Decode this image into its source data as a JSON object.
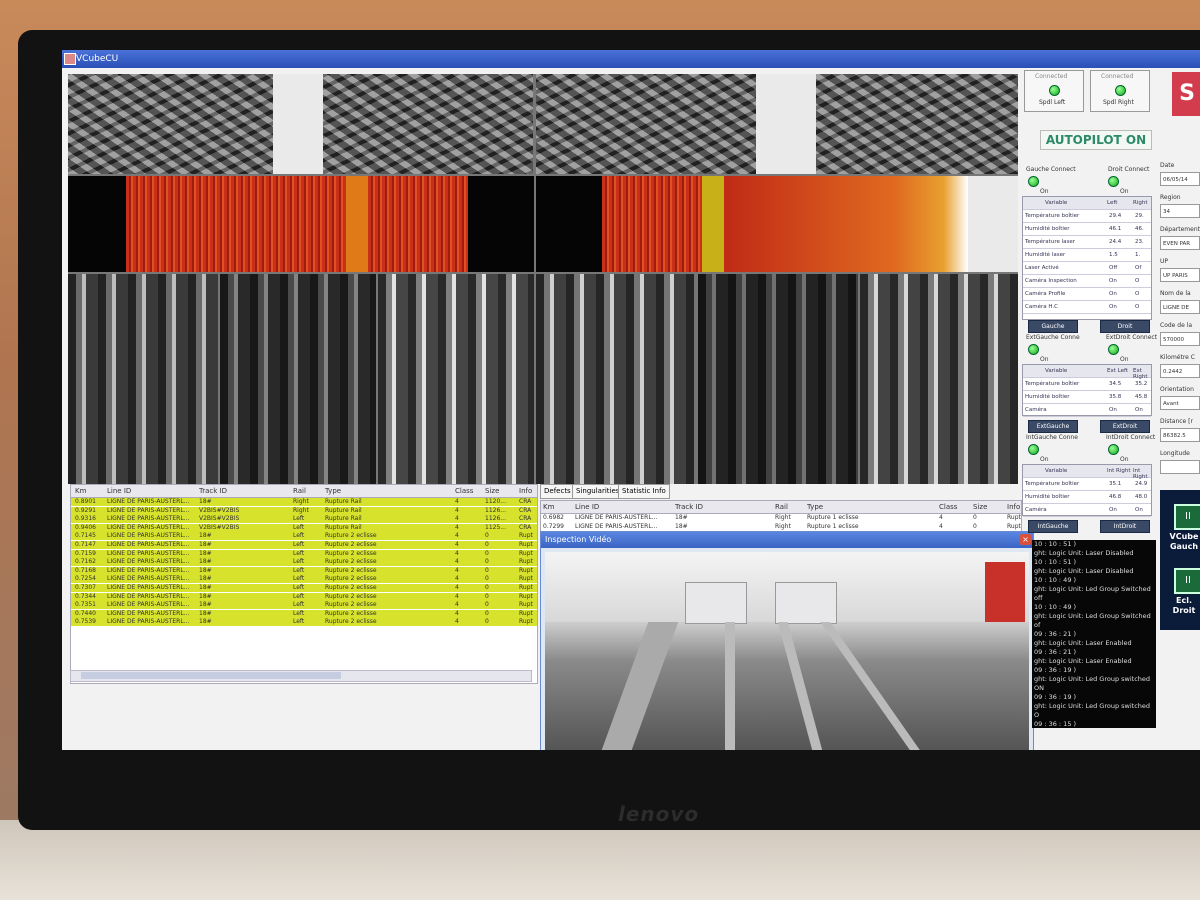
{
  "window": {
    "title": "VCubeCU"
  },
  "monitor": {
    "brand": "lenovo"
  },
  "cam_table": {
    "columns": [
      "Km",
      "Line ID",
      "Track ID",
      "Rail",
      "Type",
      "Class",
      "Size",
      "Info"
    ],
    "rows": [
      [
        "0.8901",
        "LIGNE DE PARIS-AUSTERL...",
        "18#",
        "Right",
        "Rupture Rail",
        "4",
        "1120...",
        "CRA"
      ],
      [
        "0.9291",
        "LIGNE DE PARIS-AUSTERL...",
        "V2BIS#V2BIS",
        "Right",
        "Rupture Rail",
        "4",
        "1126...",
        "CRA"
      ],
      [
        "0.9316",
        "LIGNE DE PARIS-AUSTERL...",
        "V2BIS#V2BIS",
        "Left",
        "Rupture Rail",
        "4",
        "1126...",
        "CRA"
      ],
      [
        "0.9406",
        "LIGNE DE PARIS-AUSTERL...",
        "V2BIS#V2BIS",
        "Left",
        "Rupture Rail",
        "4",
        "1125...",
        "CRA"
      ],
      [
        "0.7145",
        "LIGNE DE PARIS-AUSTERL...",
        "18#",
        "Left",
        "Rupture 2 eclisse",
        "4",
        "0",
        "Rupt"
      ],
      [
        "0.7147",
        "LIGNE DE PARIS-AUSTERL...",
        "18#",
        "Left",
        "Rupture 2 eclisse",
        "4",
        "0",
        "Rupt"
      ],
      [
        "0.7159",
        "LIGNE DE PARIS-AUSTERL...",
        "18#",
        "Left",
        "Rupture 2 eclisse",
        "4",
        "0",
        "Rupt"
      ],
      [
        "0.7162",
        "LIGNE DE PARIS-AUSTERL...",
        "18#",
        "Left",
        "Rupture 2 eclisse",
        "4",
        "0",
        "Rupt"
      ],
      [
        "0.7168",
        "LIGNE DE PARIS-AUSTERL...",
        "18#",
        "Left",
        "Rupture 2 eclisse",
        "4",
        "0",
        "Rupt"
      ],
      [
        "0.7254",
        "LIGNE DE PARIS-AUSTERL...",
        "18#",
        "Left",
        "Rupture 2 eclisse",
        "4",
        "0",
        "Rupt"
      ],
      [
        "0.7307",
        "LIGNE DE PARIS-AUSTERL...",
        "18#",
        "Left",
        "Rupture 2 eclisse",
        "4",
        "0",
        "Rupt"
      ],
      [
        "0.7344",
        "LIGNE DE PARIS-AUSTERL...",
        "18#",
        "Left",
        "Rupture 2 eclisse",
        "4",
        "0",
        "Rupt"
      ],
      [
        "0.7351",
        "LIGNE DE PARIS-AUSTERL...",
        "18#",
        "Left",
        "Rupture 2 eclisse",
        "4",
        "0",
        "Rupt"
      ],
      [
        "0.7440",
        "LIGNE DE PARIS-AUSTERL...",
        "18#",
        "Left",
        "Rupture 2 eclisse",
        "4",
        "0",
        "Rupt"
      ],
      [
        "0.7539",
        "LIGNE DE PARIS-AUSTERL...",
        "18#",
        "Left",
        "Rupture 2 eclisse",
        "4",
        "0",
        "Rupt"
      ]
    ]
  },
  "tabs": [
    "Defects",
    "Singularities",
    "Statistic Info"
  ],
  "defects_table": {
    "columns": [
      "Km",
      "Line ID",
      "Track ID",
      "Rail",
      "Type",
      "Class",
      "Size",
      "Info"
    ],
    "rows": [
      [
        "0.6982",
        "LIGNE DE PARIS-AUSTERL...",
        "18#",
        "Right",
        "Rupture 1 eclisse",
        "4",
        "0",
        "Rupt"
      ],
      [
        "0.7299",
        "LIGNE DE PARIS-AUSTERL...",
        "18#",
        "Right",
        "Rupture 1 eclisse",
        "4",
        "0",
        "Rupt"
      ]
    ]
  },
  "video": {
    "title": "Inspection Vidéo",
    "close": "×"
  },
  "status": {
    "connected": "Connected",
    "spdl_left": "Spdl Left",
    "spdl_right": "Spdl Right",
    "autopilot": "AUTOPILOT ON",
    "gauche_connect": "Gauche Connect",
    "droit_connect": "Droit Connect",
    "on": "On"
  },
  "var_table": {
    "headers": [
      "Variable",
      "Left",
      "Right"
    ],
    "rows": [
      [
        "Température boîtier",
        "29.4",
        "29."
      ],
      [
        "Humidité boîtier",
        "46.1",
        "46."
      ],
      [
        "Température laser",
        "24.4",
        "23."
      ],
      [
        "Humidité laser",
        "1.5",
        "1."
      ],
      [
        "Laser Activé",
        "Off",
        "Of"
      ],
      [
        "Caméra Inspection",
        "On",
        "O"
      ],
      [
        "Caméra Profile",
        "On",
        "O"
      ],
      [
        "Caméra H.C",
        "On",
        "O"
      ]
    ]
  },
  "buttons": {
    "gauche": "Gauche",
    "droit": "Droit",
    "ext_gauche": "ExtGauche",
    "ext_droit": "ExtDroit",
    "int_gauche": "IntGauche",
    "int_droit": "IntDroit"
  },
  "ext": {
    "left_label": "ExtGauche Conne",
    "right_label": "ExtDroit Connect",
    "headers": [
      "Variable",
      "Ext Left",
      "Ext Right"
    ],
    "rows": [
      [
        "Température boîtier",
        "34.5",
        "35.2"
      ],
      [
        "Humidité boîtier",
        "35.8",
        "45.8"
      ],
      [
        "Caméra",
        "On",
        "On"
      ]
    ]
  },
  "int": {
    "left_label": "IntGauche Conne",
    "right_label": "IntDroit Connect",
    "headers": [
      "Variable",
      "Int Right",
      "Int Right"
    ],
    "rows": [
      [
        "Température boîtier",
        "35.1",
        "24.9"
      ],
      [
        "Humidité boîtier",
        "46.8",
        "48.0"
      ],
      [
        "Caméra",
        "On",
        "On"
      ]
    ]
  },
  "log": [
    "10 : 10 : 51 )",
    "ght: Logic Unit: Laser Disabled",
    "10 : 10 : 51 )",
    "ght: Logic Unit: Laser Disabled",
    "10 : 10 : 49 )",
    "ght: Logic Unit: Led Group Switched off",
    "10 : 10 : 49 )",
    "ght: Logic Unit: Led Group Switched of",
    "09 : 36 : 21 )",
    "ght: Logic Unit: Laser Enabled",
    "09 : 36 : 21 )",
    "ght: Logic Unit: Laser Enabled",
    "09 : 36 : 19 )",
    "ght: Logic Unit: Led Group switched ON",
    "09 : 36 : 19 )",
    "ght: Logic Unit: Led Group switched O",
    "09 : 36 : 15 )",
    "ght: Logic Unit: Laser Disabled",
    "09 : 36 : 15 )",
    "ght: Logic Unit: Laser Disabled"
  ],
  "info_panel": {
    "logo": "S",
    "fields": [
      {
        "label": "Date",
        "value": "06/05/14"
      },
      {
        "label": "Region",
        "value": "34"
      },
      {
        "label": "Département",
        "value": "EVEN PAR"
      },
      {
        "label": "UP",
        "value": "UP PARIS"
      },
      {
        "label": "Nom de la",
        "value": "LIGNE DE"
      },
      {
        "label": "Code de la",
        "value": "570000"
      },
      {
        "label": "Kilométre C",
        "value": "0.2442"
      },
      {
        "label": "Orientation",
        "value": "Avant"
      },
      {
        "label": "Distance [r",
        "value": "86382.5"
      },
      {
        "label": "Longitude",
        "value": ""
      }
    ]
  },
  "control": {
    "pause": "II",
    "vcube": "VCube",
    "gauche": "Gauch",
    "ecl": "Ecl.",
    "droit": "Droit"
  },
  "status_colors": {
    "highlight": "#d6e22c",
    "led": "#22aa22"
  }
}
